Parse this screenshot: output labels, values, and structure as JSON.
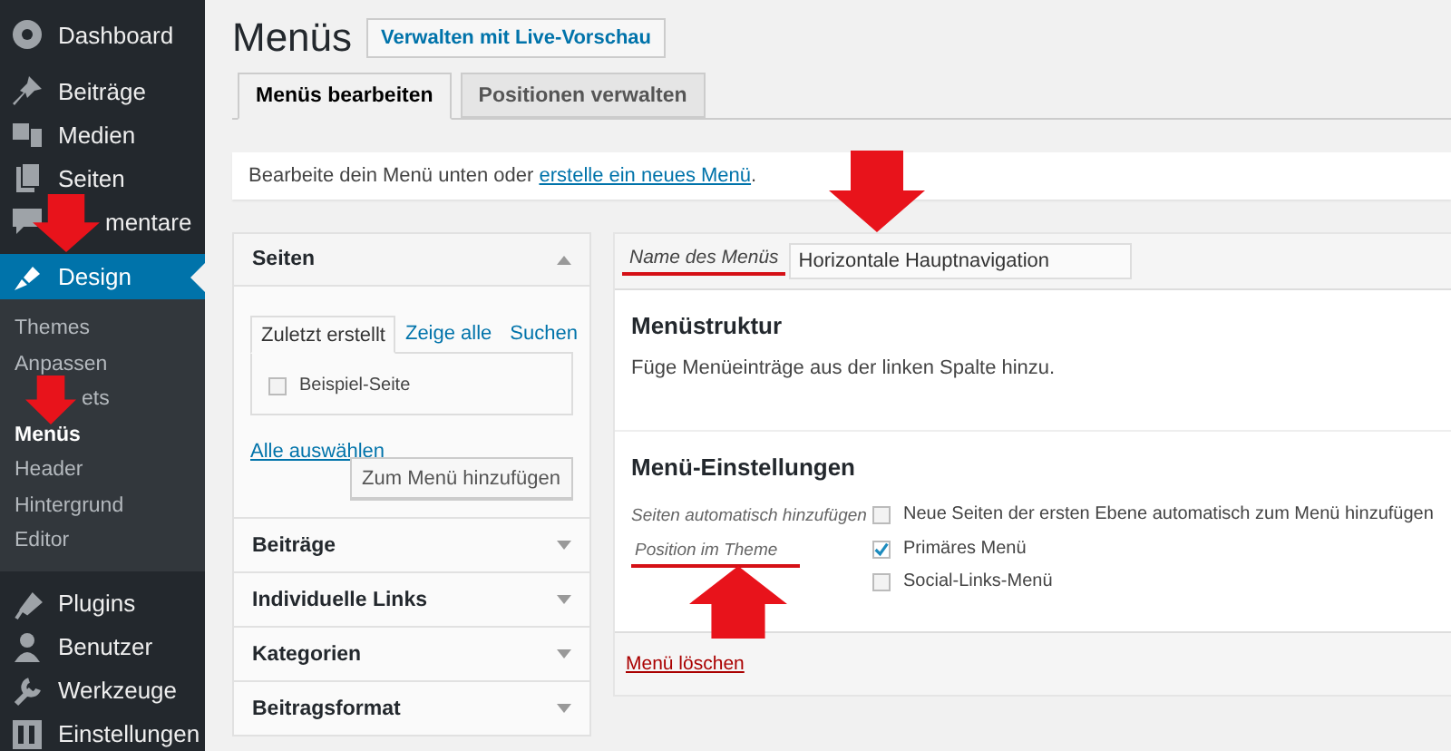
{
  "sidebar": {
    "items": [
      {
        "label": "Dashboard",
        "selected": false
      },
      {
        "label": "Beiträge",
        "selected": false
      },
      {
        "label": "Medien",
        "selected": false
      },
      {
        "label": "Seiten",
        "selected": false
      },
      {
        "label": "mentare",
        "selected": false,
        "arrow_over": true
      },
      {
        "label": "Design",
        "selected": true,
        "children": [
          {
            "label": "Themes",
            "selected": false
          },
          {
            "label": "Anpassen",
            "selected": false
          },
          {
            "label": "ets",
            "selected": false,
            "arrow_over": true
          },
          {
            "label": "Menüs",
            "selected": true
          },
          {
            "label": "Header",
            "selected": false
          },
          {
            "label": "Hintergrund",
            "selected": false
          },
          {
            "label": "Editor",
            "selected": false
          }
        ]
      },
      {
        "label": "Plugins",
        "selected": false
      },
      {
        "label": "Benutzer",
        "selected": false
      },
      {
        "label": "Werkzeuge",
        "selected": false
      },
      {
        "label": "Einstellungen",
        "selected": false
      }
    ]
  },
  "page": {
    "title": "Menüs",
    "action_button": "Verwalten mit Live-Vorschau"
  },
  "tabs": [
    {
      "label": "Menüs bearbeiten",
      "selected": true
    },
    {
      "label": "Positionen verwalten",
      "selected": false
    }
  ],
  "notice": {
    "text": "Bearbeite dein Menü unten oder ",
    "link": "erstelle ein neues Menü",
    "end": "."
  },
  "add_panel": {
    "sections": [
      {
        "title": "Seiten",
        "expanded": true,
        "tabs": [
          {
            "label": "Zuletzt erstellt",
            "selected": true
          },
          {
            "label": "Zeige alle",
            "selected": false
          },
          {
            "label": "Suchen",
            "selected": false
          }
        ],
        "items": [
          {
            "label": "Beispiel-Seite",
            "checked": false
          }
        ],
        "select_all": "Alle auswählen",
        "add_button": "Zum Menü hinzufügen"
      },
      {
        "title": "Beiträge",
        "expanded": false
      },
      {
        "title": "Individuelle Links",
        "expanded": false
      },
      {
        "title": "Kategorien",
        "expanded": false
      },
      {
        "title": "Beitragsformat",
        "expanded": false
      }
    ]
  },
  "editor": {
    "name_label": "Name des Menüs",
    "name_label_underlined": true,
    "name_value": "Horizontale Hauptnavigation",
    "name_arrow_above": true,
    "structure_title": "Menüstruktur",
    "structure_hint": "Füge Menüeinträge aus der linken Spalte hinzu.",
    "settings_title": "Menü-Einstellungen",
    "settings": [
      {
        "label": "Seiten automatisch hinzufügen",
        "options": [
          {
            "label": "Neue Seiten der ersten Ebene automatisch zum Menü hinzufügen",
            "checked": false
          }
        ]
      },
      {
        "label": "Position im Theme",
        "underlined": true,
        "arrow_below": true,
        "options": [
          {
            "label": "Primäres Menü",
            "checked": true
          },
          {
            "label": "Social-Links-Menü",
            "checked": false
          }
        ]
      }
    ],
    "delete_link": "Menü löschen"
  }
}
